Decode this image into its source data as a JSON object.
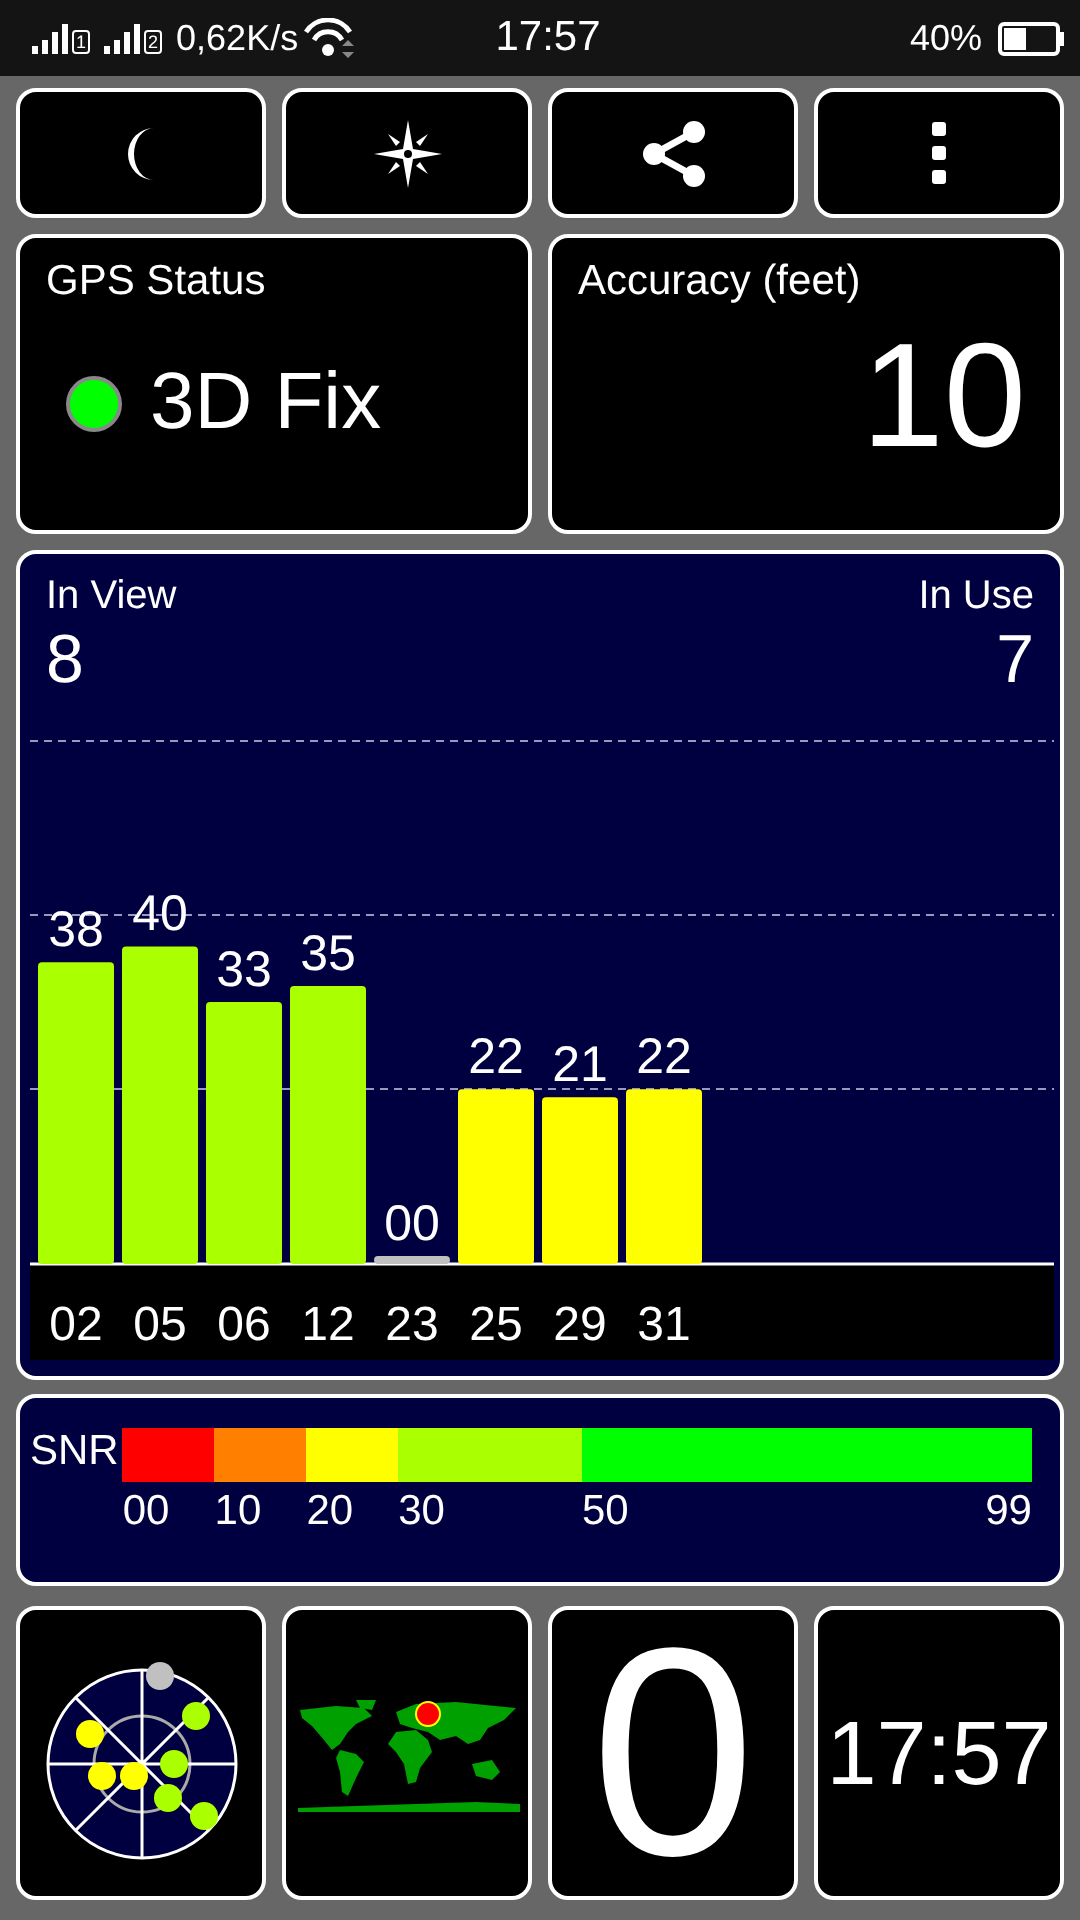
{
  "status_bar": {
    "signals": [
      {
        "sim": "1"
      },
      {
        "sim": "2"
      }
    ],
    "speed": "0,62K/s",
    "time": "17:57",
    "battery": "40%"
  },
  "toolbar": [
    {
      "kind": "night"
    },
    {
      "kind": "compass"
    },
    {
      "kind": "share"
    },
    {
      "kind": "menu"
    }
  ],
  "gps_status": {
    "title": "GPS Status",
    "value": "3D Fix",
    "fixed": true
  },
  "accuracy": {
    "title": "Accuracy (feet)",
    "value": "10"
  },
  "satellites": {
    "in_view_label": "In View",
    "in_view": "8",
    "in_use_label": "In Use",
    "in_use": "7",
    "chart_data": {
      "type": "bar",
      "categories": [
        "02",
        "05",
        "06",
        "12",
        "23",
        "25",
        "29",
        "31"
      ],
      "values": [
        38,
        40,
        33,
        35,
        0,
        22,
        21,
        22
      ],
      "value_labels": [
        "38",
        "40",
        "33",
        "35",
        "00",
        "22",
        "21",
        "22"
      ]
    }
  },
  "snr_scale": {
    "label": "SNR",
    "segments": [
      {
        "label": "00",
        "color": "#ff0000"
      },
      {
        "label": "10",
        "color": "#ff8000"
      },
      {
        "label": "20",
        "color": "#ffff00"
      },
      {
        "label": "30",
        "color": "#aaff00"
      },
      {
        "label": "50",
        "color": "#00ff00"
      }
    ],
    "end_label": "99"
  },
  "tiles": [
    {
      "kind": "skyplot"
    },
    {
      "kind": "map"
    },
    {
      "kind": "count",
      "value": "0"
    },
    {
      "kind": "clock",
      "value": "17:57"
    }
  ]
}
